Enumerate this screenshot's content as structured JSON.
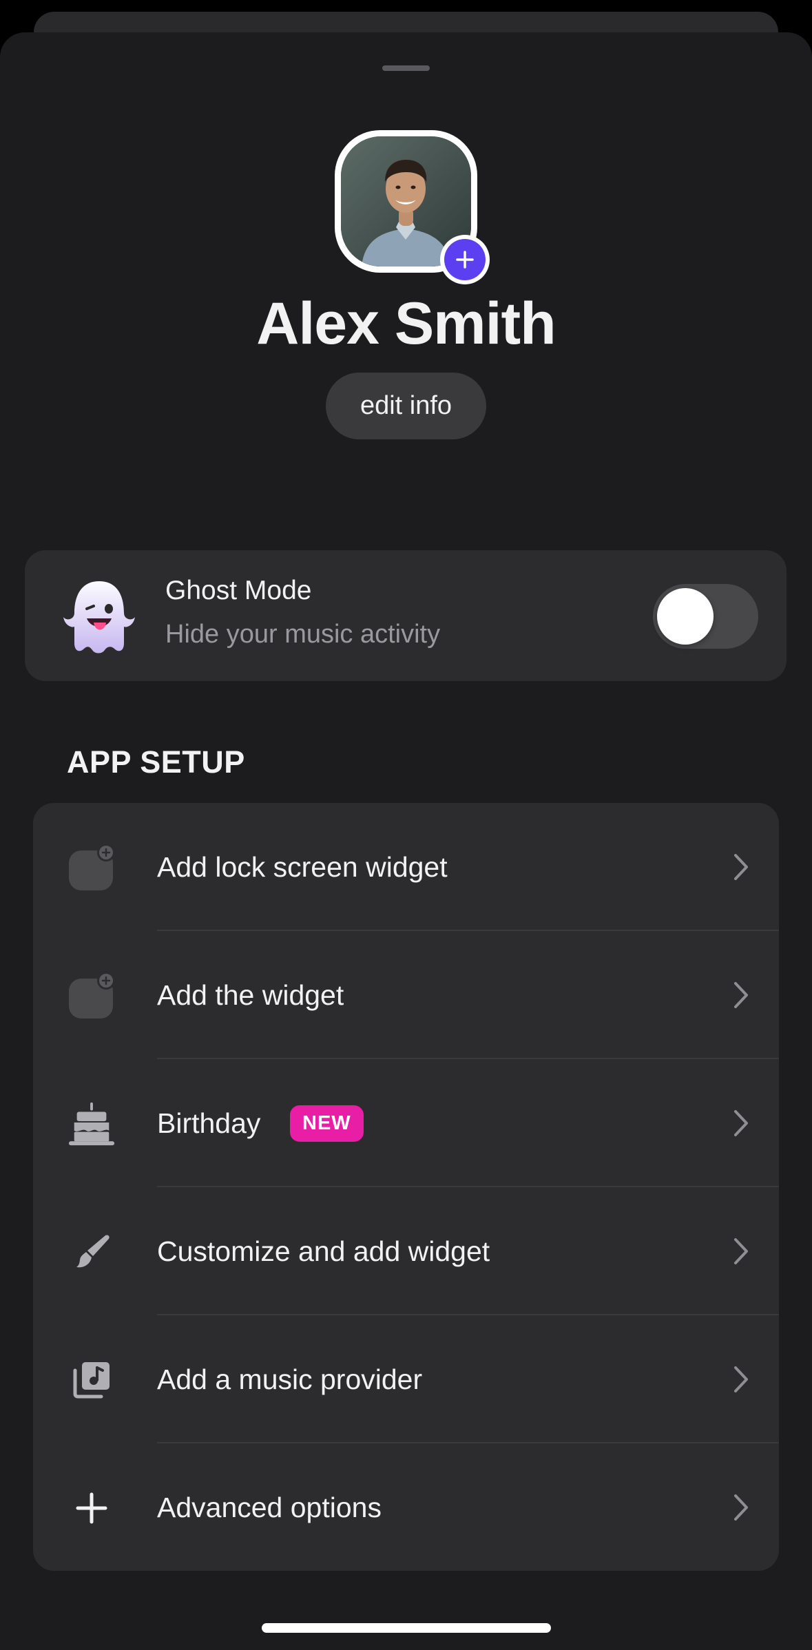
{
  "profile": {
    "name": "Alex Smith",
    "edit_label": "edit info",
    "add_photo_icon": "plus-icon"
  },
  "ghost_mode": {
    "title": "Ghost Mode",
    "subtitle": "Hide your music activity",
    "enabled": false,
    "icon": "ghost-emoji-icon"
  },
  "app_setup": {
    "title": "APP SETUP",
    "items": [
      {
        "label": "Add lock screen widget",
        "icon": "widget-add-icon"
      },
      {
        "label": "Add the widget",
        "icon": "widget-add-icon"
      },
      {
        "label": "Birthday",
        "icon": "cake-icon",
        "badge": "NEW"
      },
      {
        "label": "Customize and add widget",
        "icon": "brush-icon"
      },
      {
        "label": "Add a music provider",
        "icon": "music-library-icon"
      },
      {
        "label": "Advanced options",
        "icon": "plus-icon"
      }
    ]
  },
  "colors": {
    "background": "#1c1c1e",
    "card": "#2c2c2e",
    "accent": "#5b3ff0",
    "badge": "#e91ea6"
  }
}
